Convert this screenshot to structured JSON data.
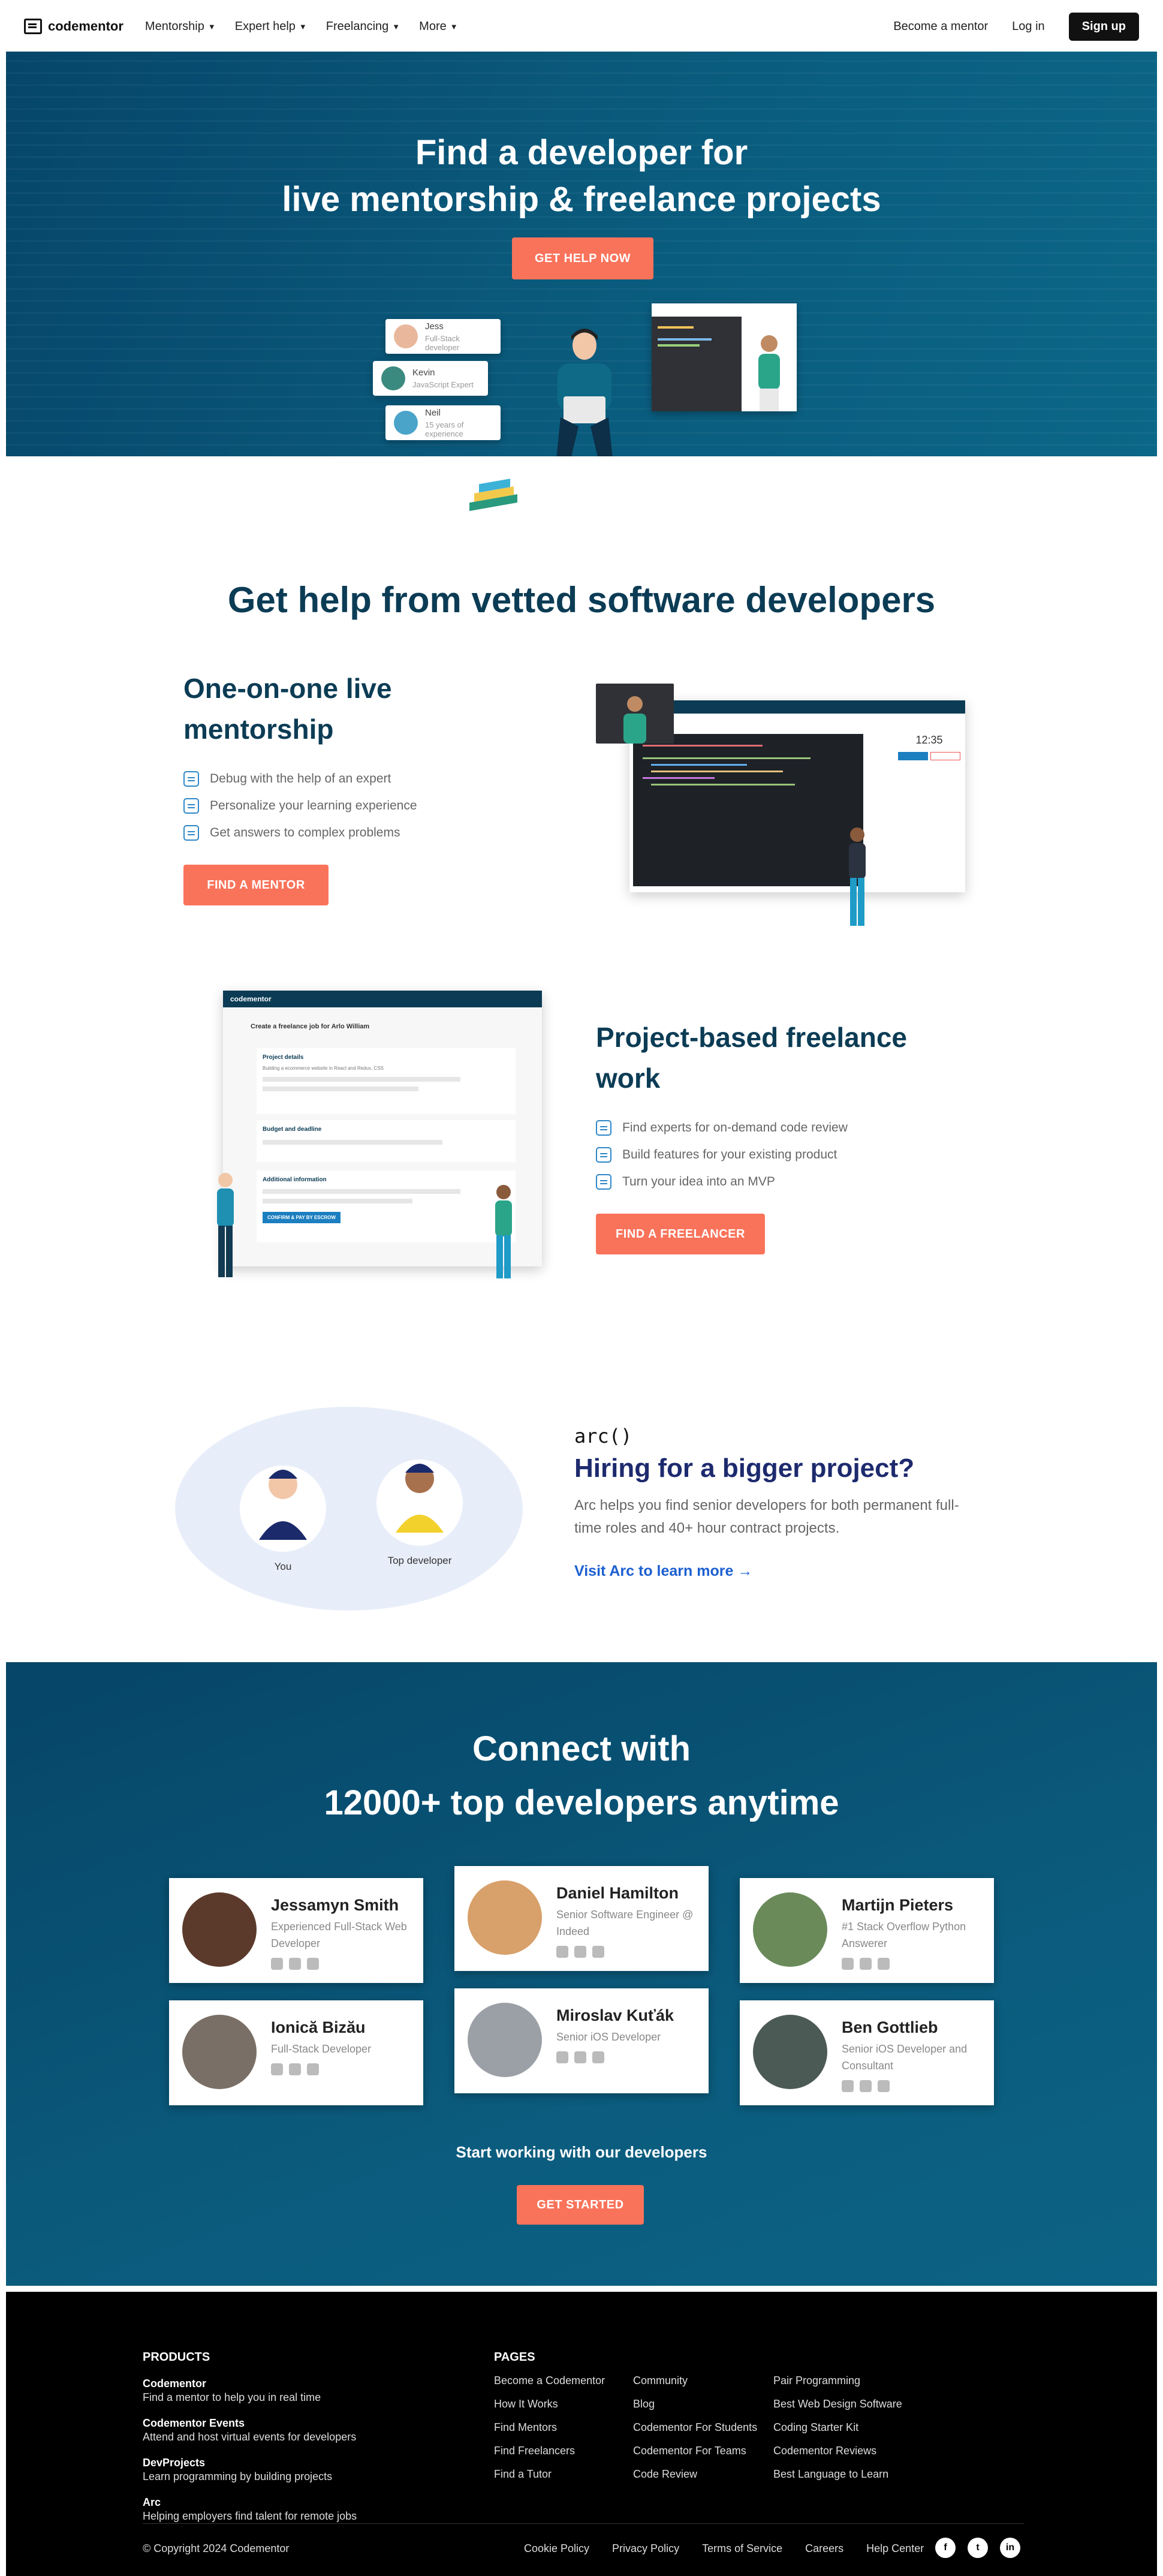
{
  "nav": {
    "logo": "codementor",
    "items": [
      "Mentorship",
      "Expert help",
      "Freelancing",
      "More"
    ],
    "become_mentor": "Become a mentor",
    "login": "Log in",
    "signup": "Sign up"
  },
  "hero": {
    "title_line1": "Find a developer for",
    "title_line2": "live mentorship & freelance projects",
    "cta": "GET HELP NOW",
    "cards": [
      {
        "name": "Jess",
        "desc": "Full-Stack developer"
      },
      {
        "name": "Kevin",
        "desc": "JavaScript Expert"
      },
      {
        "name": "Neil",
        "desc": "15 years of experience"
      }
    ]
  },
  "vetted": {
    "title": "Get help from vetted software developers",
    "mentorship": {
      "title_line1": "One-on-one live",
      "title_line2": "mentorship",
      "items": [
        "Debug with the help of an expert",
        "Personalize your learning experience",
        "Get answers to complex problems"
      ],
      "cta": "FIND A MENTOR"
    },
    "freelance": {
      "title_line1": "Project-based freelance",
      "title_line2": "work",
      "items": [
        "Find experts for on-demand code review",
        "Build features for your existing product",
        "Turn your idea into an MVP"
      ],
      "cta": "FIND A FREELANCER"
    }
  },
  "mock_freelance": {
    "logo": "codementor",
    "job_title": "Create a freelance job for Arlo William",
    "s1": "Project details",
    "s1_text": "Building a ecommerce website in React and Redux, CSS",
    "s2": "Budget and deadline",
    "s3": "Additional information",
    "confirm": "CONFIRM & PAY BY ESCROW"
  },
  "mock_mentor": {
    "time": "12:35"
  },
  "arc": {
    "logo": "arc()",
    "title": "Hiring for a bigger project?",
    "text": "Arc helps you find senior developers for both permanent full-time roles and 40+ hour contract projects.",
    "link": "Visit Arc to learn more →",
    "you": "You",
    "top_dev": "Top developer"
  },
  "connect": {
    "title_line1": "Connect with",
    "title_line2": "12000+ top developers anytime",
    "developers": [
      {
        "name": "Jessamyn Smith",
        "role": "Experienced Full-Stack Web Developer"
      },
      {
        "name": "Daniel Hamilton",
        "role": "Senior Software Engineer @ Indeed"
      },
      {
        "name": "Martijn Pieters",
        "role": "#1 Stack Overflow Python Answerer"
      },
      {
        "name": "Ionică Bizău",
        "role": "Full-Stack Developer"
      },
      {
        "name": "Miroslav Kuťák",
        "role": "Senior iOS Developer"
      },
      {
        "name": "Ben Gottlieb",
        "role": "Senior iOS Developer and Consultant"
      }
    ],
    "start_text": "Start working with our developers",
    "cta": "GET STARTED"
  },
  "footer": {
    "products_heading": "PRODUCTS",
    "products": [
      {
        "title": "Codementor",
        "desc": "Find a mentor to help you in real time"
      },
      {
        "title": "Codementor Events",
        "desc": "Attend and host virtual events for developers"
      },
      {
        "title": "DevProjects",
        "desc": "Learn programming by building projects"
      },
      {
        "title": "Arc",
        "desc": "Helping employers find talent for remote jobs"
      }
    ],
    "pages_heading": "PAGES",
    "pages_col1": [
      "Become a Codementor",
      "How It Works",
      "Find Mentors",
      "Find Freelancers",
      "Find a Tutor"
    ],
    "pages_col2": [
      "Community",
      "Blog",
      "Codementor For Students",
      "Codementor For Teams",
      "Code Review"
    ],
    "pages_col3": [
      "Pair Programming",
      "Best Web Design Software",
      "Coding Starter Kit",
      "Codementor Reviews",
      "Best Language to Learn"
    ],
    "copyright": "© Copyright 2024 Codementor",
    "bottom_links": [
      "Cookie Policy",
      "Privacy Policy",
      "Terms of Service",
      "Careers",
      "Help Center"
    ],
    "social": [
      "f",
      "t",
      "in"
    ]
  },
  "colors": {
    "coral": "#f9735b",
    "navy": "#0c3c55",
    "hero_bg": "#0a5a7c",
    "arc_blue": "#1c5fd1"
  }
}
